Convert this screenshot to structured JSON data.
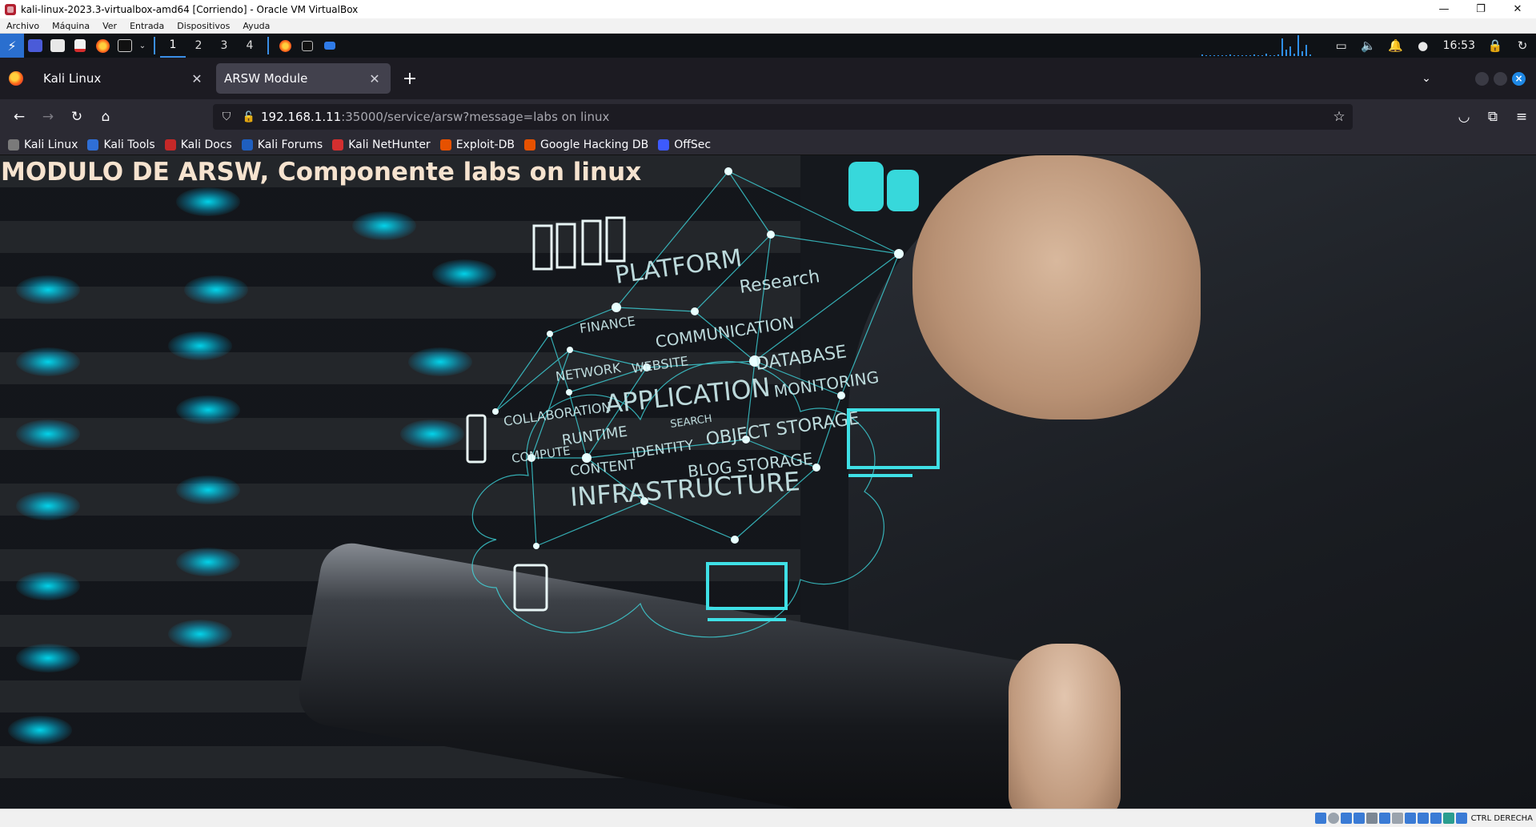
{
  "host_window": {
    "title": "kali-linux-2023.3-virtualbox-amd64 [Corriendo] - Oracle VM VirtualBox",
    "controls": {
      "minimize": "—",
      "restore": "❐",
      "close": "✕"
    },
    "menu": [
      "Archivo",
      "Máquina",
      "Ver",
      "Entrada",
      "Dispositivos",
      "Ayuda"
    ],
    "status_host_key": "CTRL DERECHA"
  },
  "kali_panel": {
    "workspaces": [
      "1",
      "2",
      "3",
      "4"
    ],
    "active_workspace": "1",
    "clock": "16:53",
    "launcher_icons": [
      "kali-menu-icon",
      "desktop-icon",
      "file-manager-icon",
      "text-editor-icon",
      "firefox-icon",
      "terminal-icon"
    ],
    "tray_icons": [
      "window-icon",
      "volume-icon",
      "notification-bell-icon",
      "power-icon",
      "lock-icon",
      "refresh-icon"
    ],
    "cpu_graph": [
      2,
      1,
      1,
      1,
      1,
      1,
      1,
      2,
      1,
      1,
      1,
      1,
      1,
      2,
      1,
      1,
      3,
      1,
      1,
      2,
      22,
      8,
      12,
      3,
      26,
      6,
      14,
      2
    ]
  },
  "browser": {
    "tabs": [
      {
        "label": "Kali Linux",
        "active": false,
        "close": "✕"
      },
      {
        "label": "ARSW Module",
        "active": true,
        "close": "✕"
      }
    ],
    "new_tab": "+",
    "url_host": "192.168.1.11",
    "url_rest": ":35000/service/arsw?message=labs on linux",
    "bookmarks": [
      {
        "label": "Kali Linux",
        "color": "#7a7a7a"
      },
      {
        "label": "Kali Tools",
        "color": "#2f6fd6"
      },
      {
        "label": "Kali Docs",
        "color": "#c62828"
      },
      {
        "label": "Kali Forums",
        "color": "#1f5fbf"
      },
      {
        "label": "Kali NetHunter",
        "color": "#d32f2f"
      },
      {
        "label": "Exploit-DB",
        "color": "#e65100"
      },
      {
        "label": "Google Hacking DB",
        "color": "#e65100"
      },
      {
        "label": "OffSec",
        "color": "#3d5afe"
      }
    ]
  },
  "page": {
    "heading": "MODULO DE ARSW, Componente labs on linux",
    "cloud_words": [
      "PLATFORM",
      "Research",
      "FINANCE",
      "COMMUNICATION",
      "NETWORK",
      "WEBSITE",
      "DATABASE",
      "COLLABORATION",
      "APPLICATION",
      "MONITORING",
      "SEARCH",
      "RUNTIME",
      "OBJECT STORAGE",
      "COMPUTE",
      "IDENTITY",
      "CONTENT",
      "BLOG STORAGE",
      "INFRASTRUCTURE"
    ],
    "accent": "#3fe0e6"
  }
}
